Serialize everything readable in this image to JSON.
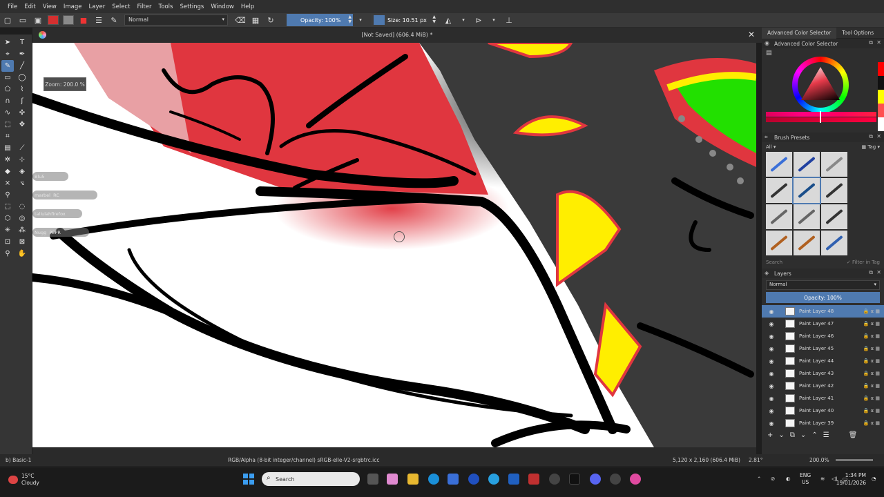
{
  "menu": [
    "File",
    "Edit",
    "View",
    "Image",
    "Layer",
    "Select",
    "Filter",
    "Tools",
    "Settings",
    "Window",
    "Help"
  ],
  "toolbar": {
    "blend_mode": "Normal",
    "opacity_label": "Opacity: 100%",
    "size_label": "Size: 10.51 px"
  },
  "document": {
    "title": "[Not Saved]  (606.4 MiB) *",
    "zoom_tooltip": "Zoom: 200.0 %"
  },
  "canvas_overlays": {
    "user_tags": [
      "Blu5",
      "marbel",
      "RC",
      "tallulahfirefox",
      "Nugg",
      "PEPR"
    ]
  },
  "dock": {
    "tabs": [
      "Advanced Color Selector",
      "Tool Options"
    ],
    "color_panel_title": "Advanced Color Selector",
    "brush_panel_title": "Brush Presets",
    "brush_filter": "All",
    "brush_tag_label": "Tag",
    "brush_search_placeholder": "Search",
    "filter_in_tag": "Filter in Tag",
    "layers_title": "Layers",
    "layer_blend": "Normal",
    "layer_opacity": "Opacity: 100%",
    "layers": [
      {
        "name": "Paint Layer 48",
        "selected": true
      },
      {
        "name": "Paint Layer 47",
        "selected": false
      },
      {
        "name": "Paint Layer 46",
        "selected": false
      },
      {
        "name": "Paint Layer 45",
        "selected": false
      },
      {
        "name": "Paint Layer 44",
        "selected": false
      },
      {
        "name": "Paint Layer 43",
        "selected": false
      },
      {
        "name": "Paint Layer 42",
        "selected": false
      },
      {
        "name": "Paint Layer 41",
        "selected": false
      },
      {
        "name": "Paint Layer 40",
        "selected": false
      },
      {
        "name": "Paint Layer 39",
        "selected": false
      }
    ]
  },
  "status": {
    "brush": "b) Basic-1",
    "color_profile": "RGB/Alpha (8-bit integer/channel)  sRGB-elle-V2-srgbtrc.icc",
    "dimensions": "5,120 x 2,160 (606.4 MiB)",
    "rotation": "2.81°",
    "zoom": "200.0%"
  },
  "taskbar": {
    "weather_temp": "15°C",
    "weather_desc": "Cloudy",
    "search_placeholder": "Search",
    "lang_top": "ENG",
    "lang_bottom": "US",
    "time": "1:34 PM",
    "date": "19/01/2026"
  },
  "colors": {
    "accent": "#4f7ab0",
    "canvas_red": "#e0363f",
    "canvas_yellow": "#ffee00",
    "canvas_green": "#22e000"
  }
}
